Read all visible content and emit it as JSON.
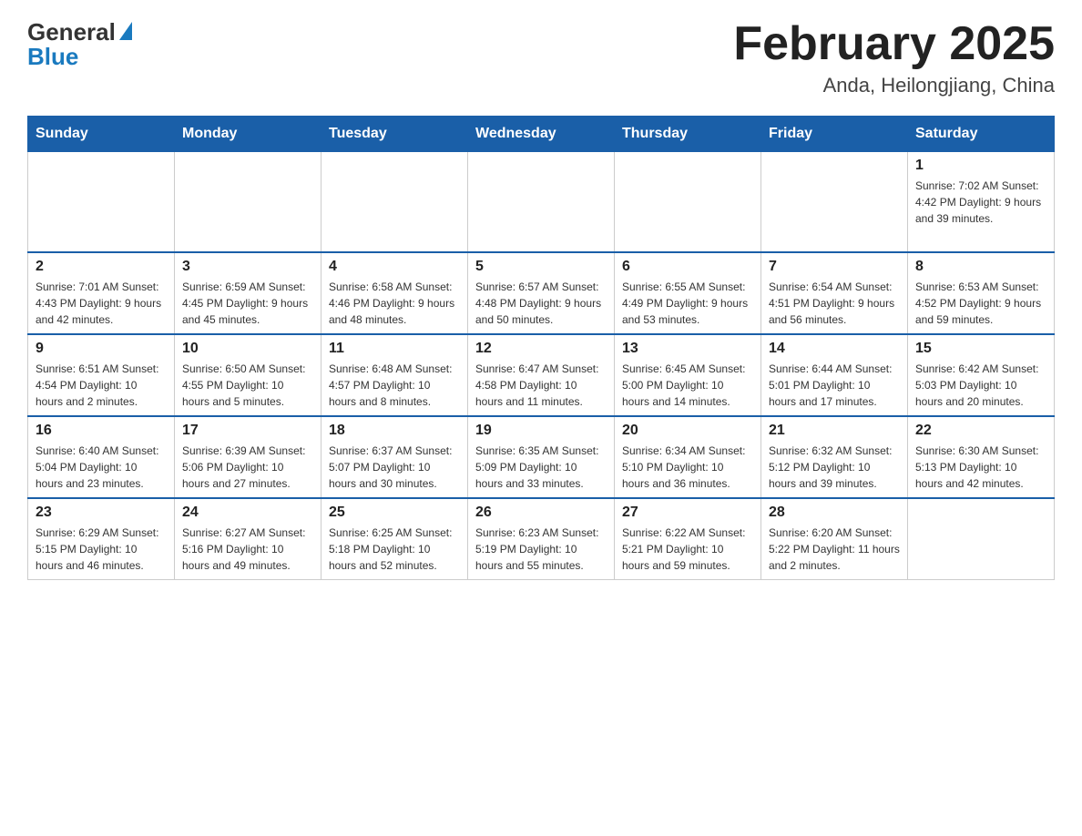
{
  "logo": {
    "general": "General",
    "blue": "Blue"
  },
  "title": "February 2025",
  "subtitle": "Anda, Heilongjiang, China",
  "days_of_week": [
    "Sunday",
    "Monday",
    "Tuesday",
    "Wednesday",
    "Thursday",
    "Friday",
    "Saturday"
  ],
  "weeks": [
    [
      {
        "day": "",
        "info": ""
      },
      {
        "day": "",
        "info": ""
      },
      {
        "day": "",
        "info": ""
      },
      {
        "day": "",
        "info": ""
      },
      {
        "day": "",
        "info": ""
      },
      {
        "day": "",
        "info": ""
      },
      {
        "day": "1",
        "info": "Sunrise: 7:02 AM\nSunset: 4:42 PM\nDaylight: 9 hours and 39 minutes."
      }
    ],
    [
      {
        "day": "2",
        "info": "Sunrise: 7:01 AM\nSunset: 4:43 PM\nDaylight: 9 hours and 42 minutes."
      },
      {
        "day": "3",
        "info": "Sunrise: 6:59 AM\nSunset: 4:45 PM\nDaylight: 9 hours and 45 minutes."
      },
      {
        "day": "4",
        "info": "Sunrise: 6:58 AM\nSunset: 4:46 PM\nDaylight: 9 hours and 48 minutes."
      },
      {
        "day": "5",
        "info": "Sunrise: 6:57 AM\nSunset: 4:48 PM\nDaylight: 9 hours and 50 minutes."
      },
      {
        "day": "6",
        "info": "Sunrise: 6:55 AM\nSunset: 4:49 PM\nDaylight: 9 hours and 53 minutes."
      },
      {
        "day": "7",
        "info": "Sunrise: 6:54 AM\nSunset: 4:51 PM\nDaylight: 9 hours and 56 minutes."
      },
      {
        "day": "8",
        "info": "Sunrise: 6:53 AM\nSunset: 4:52 PM\nDaylight: 9 hours and 59 minutes."
      }
    ],
    [
      {
        "day": "9",
        "info": "Sunrise: 6:51 AM\nSunset: 4:54 PM\nDaylight: 10 hours and 2 minutes."
      },
      {
        "day": "10",
        "info": "Sunrise: 6:50 AM\nSunset: 4:55 PM\nDaylight: 10 hours and 5 minutes."
      },
      {
        "day": "11",
        "info": "Sunrise: 6:48 AM\nSunset: 4:57 PM\nDaylight: 10 hours and 8 minutes."
      },
      {
        "day": "12",
        "info": "Sunrise: 6:47 AM\nSunset: 4:58 PM\nDaylight: 10 hours and 11 minutes."
      },
      {
        "day": "13",
        "info": "Sunrise: 6:45 AM\nSunset: 5:00 PM\nDaylight: 10 hours and 14 minutes."
      },
      {
        "day": "14",
        "info": "Sunrise: 6:44 AM\nSunset: 5:01 PM\nDaylight: 10 hours and 17 minutes."
      },
      {
        "day": "15",
        "info": "Sunrise: 6:42 AM\nSunset: 5:03 PM\nDaylight: 10 hours and 20 minutes."
      }
    ],
    [
      {
        "day": "16",
        "info": "Sunrise: 6:40 AM\nSunset: 5:04 PM\nDaylight: 10 hours and 23 minutes."
      },
      {
        "day": "17",
        "info": "Sunrise: 6:39 AM\nSunset: 5:06 PM\nDaylight: 10 hours and 27 minutes."
      },
      {
        "day": "18",
        "info": "Sunrise: 6:37 AM\nSunset: 5:07 PM\nDaylight: 10 hours and 30 minutes."
      },
      {
        "day": "19",
        "info": "Sunrise: 6:35 AM\nSunset: 5:09 PM\nDaylight: 10 hours and 33 minutes."
      },
      {
        "day": "20",
        "info": "Sunrise: 6:34 AM\nSunset: 5:10 PM\nDaylight: 10 hours and 36 minutes."
      },
      {
        "day": "21",
        "info": "Sunrise: 6:32 AM\nSunset: 5:12 PM\nDaylight: 10 hours and 39 minutes."
      },
      {
        "day": "22",
        "info": "Sunrise: 6:30 AM\nSunset: 5:13 PM\nDaylight: 10 hours and 42 minutes."
      }
    ],
    [
      {
        "day": "23",
        "info": "Sunrise: 6:29 AM\nSunset: 5:15 PM\nDaylight: 10 hours and 46 minutes."
      },
      {
        "day": "24",
        "info": "Sunrise: 6:27 AM\nSunset: 5:16 PM\nDaylight: 10 hours and 49 minutes."
      },
      {
        "day": "25",
        "info": "Sunrise: 6:25 AM\nSunset: 5:18 PM\nDaylight: 10 hours and 52 minutes."
      },
      {
        "day": "26",
        "info": "Sunrise: 6:23 AM\nSunset: 5:19 PM\nDaylight: 10 hours and 55 minutes."
      },
      {
        "day": "27",
        "info": "Sunrise: 6:22 AM\nSunset: 5:21 PM\nDaylight: 10 hours and 59 minutes."
      },
      {
        "day": "28",
        "info": "Sunrise: 6:20 AM\nSunset: 5:22 PM\nDaylight: 11 hours and 2 minutes."
      },
      {
        "day": "",
        "info": ""
      }
    ]
  ]
}
